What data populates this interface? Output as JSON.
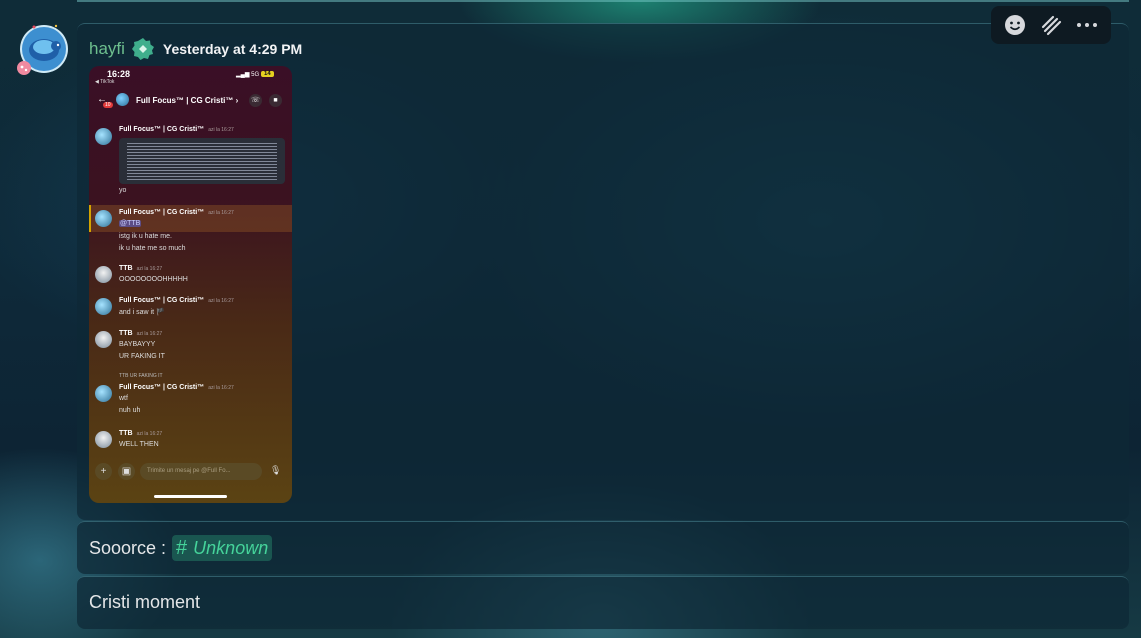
{
  "message": {
    "username": "hayfi",
    "timestamp": "Yesterday at 4:29 PM",
    "avatar_icon": "turtle-avatar-icon",
    "badge_icon": "app-badge-icon",
    "username_color": "#6dbf8e"
  },
  "toolbar": {
    "items": [
      {
        "name": "add-reaction-icon"
      },
      {
        "name": "super-reaction-icon"
      },
      {
        "name": "more-options-icon"
      }
    ]
  },
  "source_line": {
    "label": "Sooorce :",
    "channel_prefix": "#",
    "channel_name": "Unknown"
  },
  "caption": "Cristi moment",
  "screenshot": {
    "status_time": "16:28",
    "status_sub": "◀ TikTok",
    "network": "5G",
    "battery": "14",
    "unread_count": "10",
    "chat_title": "Full Focus™ | CG Cristi™ ›",
    "messages": [
      {
        "author": "Full Focus™ | CG Cristi™",
        "time": "azi la 16:27",
        "lines": [
          "yo"
        ],
        "avatar": "globe"
      },
      {
        "author": "Full Focus™ | CG Cristi™",
        "time": "azi la 16:27",
        "mention": "@TTB",
        "lines": [
          "istg ik u hate me.",
          "ik u hate me so much"
        ],
        "avatar": "globe"
      },
      {
        "author": "TTB",
        "time": "azi la 16:27",
        "lines": [
          "OOOOOOOOHHHHH"
        ],
        "avatar": "ttb"
      },
      {
        "author": "Full Focus™ | CG Cristi™",
        "time": "azi la 16:27",
        "lines": [
          "and i saw it 🏴"
        ],
        "avatar": "globe"
      },
      {
        "author": "TTB",
        "time": "azi la 16:27",
        "lines": [
          "BAYBAYYY",
          "UR FAKING IT"
        ],
        "avatar": "ttb"
      },
      {
        "reply": "TTB  UR FAKING IT",
        "author": "Full Focus™ | CG Cristi™",
        "time": "azi la 16:27",
        "lines": [
          "wtf",
          "nuh uh"
        ],
        "avatar": "globe"
      },
      {
        "author": "TTB",
        "time": "azi la 16:27",
        "lines": [
          "WELL THEN"
        ],
        "avatar": "ttb"
      }
    ],
    "input_placeholder": "Trimite un mesaj pe @Full Fo..."
  }
}
